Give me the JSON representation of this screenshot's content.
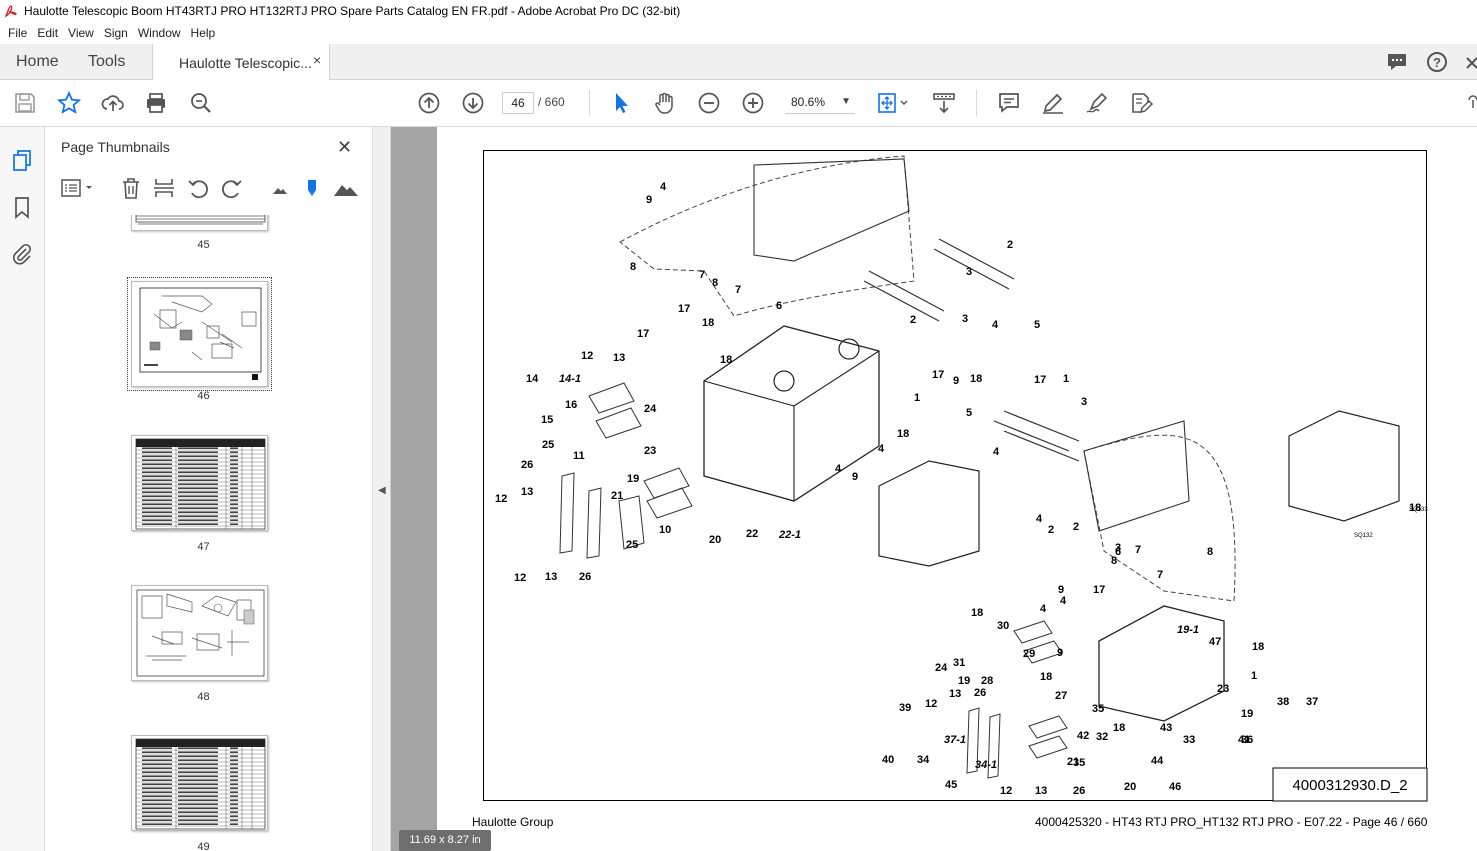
{
  "window": {
    "title": "Haulotte Telescopic Boom HT43RTJ PRO HT132RTJ PRO Spare Parts Catalog EN FR.pdf - Adobe Acrobat Pro DC (32-bit)"
  },
  "menu": [
    "File",
    "Edit",
    "View",
    "Sign",
    "Window",
    "Help"
  ],
  "tabs": {
    "home": "Home",
    "tools": "Tools",
    "document": "Haulotte Telescopic...",
    "close": "×"
  },
  "toolbar": {
    "current_page": "46",
    "page_total": "/ 660",
    "zoom": "80.6%"
  },
  "panel": {
    "title": "Page Thumbnails",
    "close": "✕",
    "thumbnails": [
      {
        "label": "45",
        "kind": "table"
      },
      {
        "label": "46",
        "kind": "drawing",
        "selected": true
      },
      {
        "label": "47",
        "kind": "table"
      },
      {
        "label": "48",
        "kind": "drawing"
      },
      {
        "label": "49",
        "kind": "table"
      }
    ]
  },
  "document": {
    "drawing_code": "4000312930.D_2",
    "footer_left": "Haulotte Group",
    "footer_right": "4000425320 - HT43 RTJ PRO_HT132 RTJ PRO - E07.22 - Page 46 / 660",
    "callouts": [
      "4",
      "9",
      "8",
      "7",
      "8",
      "7",
      "6",
      "2",
      "3",
      "2",
      "3",
      "4",
      "5",
      "17",
      "18",
      "17",
      "12",
      "13",
      "18",
      "14",
      "14-1",
      "16",
      "24",
      "15",
      "23",
      "25",
      "11",
      "26",
      "19",
      "21",
      "12",
      "13",
      "10",
      "20",
      "22",
      "22-1",
      "12",
      "13",
      "26",
      "25",
      "4",
      "9",
      "18",
      "17",
      "1",
      "4",
      "9",
      "18",
      "17",
      "1",
      "5",
      "4",
      "3",
      "4",
      "2",
      "3",
      "2",
      "6",
      "7",
      "8",
      "7",
      "8",
      "4",
      "9",
      "17",
      "18",
      "30",
      "29",
      "9",
      "4",
      "31",
      "18",
      "24",
      "28",
      "19",
      "19-1",
      "47",
      "18",
      "1",
      "39",
      "12",
      "13",
      "26",
      "27",
      "23",
      "38",
      "37",
      "37-1",
      "35",
      "19",
      "42",
      "32",
      "18",
      "43",
      "41",
      "36",
      "40",
      "34",
      "34-1",
      "35",
      "21",
      "33",
      "44",
      "45",
      "12",
      "13",
      "26",
      "20",
      "46",
      "18",
      "SQ132",
      "SQ133",
      "SQ132"
    ]
  },
  "status": {
    "page_size": "11.69 x 8.27 in"
  }
}
